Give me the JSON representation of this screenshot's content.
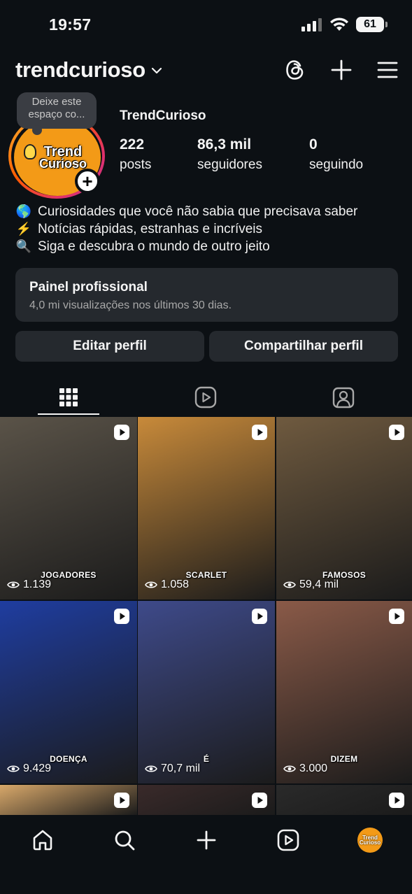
{
  "status_bar": {
    "time": "19:57",
    "battery": "61"
  },
  "header": {
    "username": "trendcurioso"
  },
  "profile": {
    "note_placeholder": "Deixe este espaço co...",
    "avatar_logo_line1": "Trend",
    "avatar_logo_line2": "Curioso",
    "display_name": "TrendCurioso",
    "stats": [
      {
        "value": "222",
        "label": "posts"
      },
      {
        "value": "86,3 mil",
        "label": "seguidores"
      },
      {
        "value": "0",
        "label": "seguindo"
      }
    ],
    "bio": [
      {
        "emoji": "🌎",
        "text": "Curiosidades que você não sabia que precisava saber"
      },
      {
        "emoji": "⚡",
        "text": "Notícias rápidas, estranhas e incríveis"
      },
      {
        "emoji": "🔍",
        "text": "Siga e descubra o mundo de outro jeito"
      }
    ]
  },
  "professional_panel": {
    "title": "Painel profissional",
    "subtitle": "4,0 mi visualizações nos últimos 30 dias."
  },
  "buttons": {
    "edit_profile": "Editar perfil",
    "share_profile": "Compartilhar perfil"
  },
  "tabs": [
    "grid-icon",
    "reels-icon",
    "tagged-icon"
  ],
  "grid": [
    {
      "caption": "JOGADORES",
      "views": "1.139",
      "bg": "#5a5348"
    },
    {
      "caption": "SCARLET",
      "views": "1.058",
      "bg": "#c88a3a"
    },
    {
      "caption": "FAMOSOS",
      "views": "59,4 mil",
      "bg": "#6f5a3f"
    },
    {
      "caption": "DOENÇA",
      "views": "9.429",
      "bg": "#1f3da0"
    },
    {
      "caption": "É",
      "views": "70,7 mil",
      "bg": "#3e4a8a"
    },
    {
      "caption": "DIZEM",
      "views": "3.000",
      "bg": "#8a5a48"
    },
    {
      "caption": "",
      "views": "",
      "bg": "#d8a86a"
    },
    {
      "caption": "",
      "views": "",
      "bg": "#3a2a2a"
    },
    {
      "caption": "",
      "views": "",
      "bg": "#2a2a2a"
    }
  ],
  "bottom_nav": {
    "avatar_text1": "Trend",
    "avatar_text2": "Curioso"
  },
  "colors": {
    "background": "#0c1014",
    "panel": "#25292e",
    "logo": "#f39a17"
  }
}
